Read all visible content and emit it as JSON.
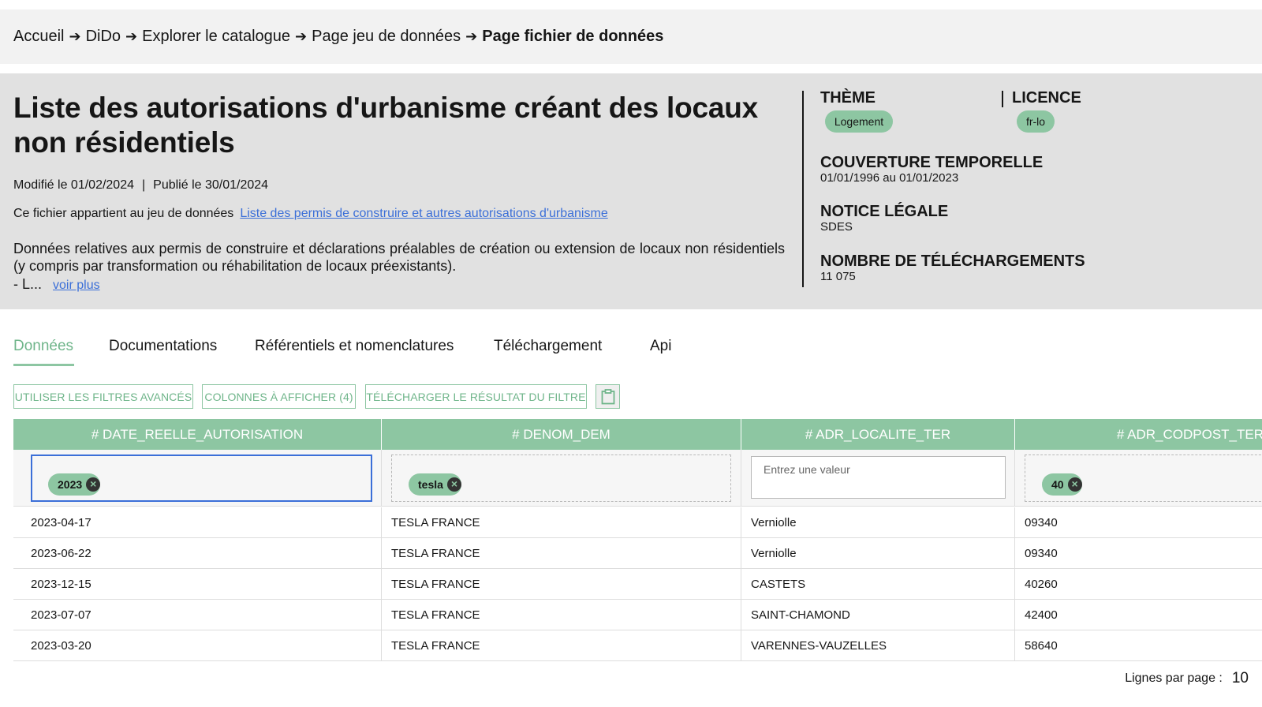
{
  "breadcrumb": [
    "Accueil",
    "DiDo",
    "Explorer le catalogue",
    "Page jeu de données",
    "Page fichier de données"
  ],
  "header": {
    "title": "Liste des autorisations d'urbanisme créant des locaux non résidentiels",
    "modified": "Modifié le 01/02/2024",
    "published": "Publié le 30/01/2024",
    "belongs_text": "Ce fichier appartient au jeu de données",
    "belongs_link": "Liste des permis de construire et autres autorisations d'urbanisme",
    "description": "Données relatives aux permis de construire et déclarations préalables de création ou extension de locaux non résidentiels (y compris par transformation ou réhabilitation de locaux préexistants).",
    "description_more": "- L...",
    "voir_plus": "voir plus"
  },
  "meta": {
    "theme_label": "Thème",
    "theme_value": "Logement",
    "licence_label": "Licence",
    "licence_value": "fr-lo",
    "coverage_label": "Couverture temporelle",
    "coverage_value": "01/01/1996 au 01/01/2023",
    "notice_label": "Notice légale",
    "notice_value": "SDES",
    "downloads_label": "Nombre de téléchargements",
    "downloads_value": "11 075"
  },
  "tabs": [
    "Données",
    "Documentations",
    "Référentiels et nomenclatures",
    "Téléchargement",
    "Api"
  ],
  "toolbar": {
    "advanced_filters": "UTILISER LES FILTRES AVANCÉS",
    "columns": "COLONNES À AFFICHER (4)",
    "download_filter": "TÉLÉCHARGER LE RÉSULTAT DU FILTRE",
    "clipboard_icon": "clipboard-icon"
  },
  "table": {
    "columns": [
      "# DATE_REELLE_AUTORISATION",
      "# DENOM_DEM",
      "# ADR_LOCALITE_TER",
      "# ADR_CODPOST_TER"
    ],
    "filters": {
      "date_chip": "2023",
      "denom_chip": "tesla",
      "localite_placeholder": "Entrez une valeur",
      "codpost_chip": "40"
    },
    "rows": [
      [
        "2023-04-17",
        "TESLA FRANCE",
        "Verniolle",
        "09340"
      ],
      [
        "2023-06-22",
        "TESLA FRANCE",
        "Verniolle",
        "09340"
      ],
      [
        "2023-12-15",
        "TESLA FRANCE",
        "CASTETS",
        "40260"
      ],
      [
        "2023-07-07",
        "TESLA FRANCE",
        "SAINT-CHAMOND",
        "42400"
      ],
      [
        "2023-03-20",
        "TESLA FRANCE",
        "VARENNES-VAUZELLES",
        "58640"
      ]
    ]
  },
  "pagination": {
    "rows_per_page_label": "Lignes par page :",
    "rows_per_page_value": "10"
  },
  "colors": {
    "accent": "#8dc6a2",
    "link": "#3b6fd8",
    "header_bg": "#e1e1e1"
  }
}
